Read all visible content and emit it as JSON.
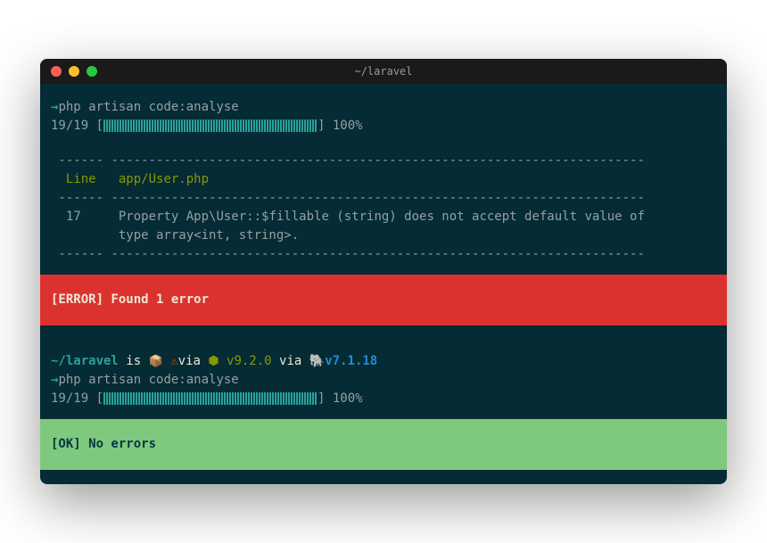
{
  "window": {
    "title": "~/laravel"
  },
  "session1": {
    "prompt_arrow": "→",
    "command": "php artisan code:analyse",
    "progress_prefix": "19/19 [",
    "progress_suffix": "] 100%",
    "table": {
      "dashes_left": " ------ ",
      "dashes_right": "----------------------------------------------------------------------- ",
      "line_header": "  Line ",
      "file_header": "  app/User.php",
      "line_num": "  17   ",
      "message_line1": "  Property App\\User::$fillable (string) does not accept default value of",
      "message_line2": "         type array<int, string>."
    },
    "error_banner": "[ERROR] Found 1 error"
  },
  "prompt_line": {
    "path": "~/laravel",
    "is_text": " is ",
    "box_icon": "📦",
    "warn_icon": "⚠",
    "via1": "via ",
    "node_icon": "⬢ ",
    "version1": "v9.2.0",
    "via2": " via ",
    "php_icon": "🐘",
    "version2": "v7.1.18"
  },
  "session2": {
    "prompt_arrow": "→",
    "command": "php artisan code:analyse",
    "progress_prefix": "19/19 [",
    "progress_suffix": "] 100%",
    "ok_banner": "[OK] No errors"
  }
}
